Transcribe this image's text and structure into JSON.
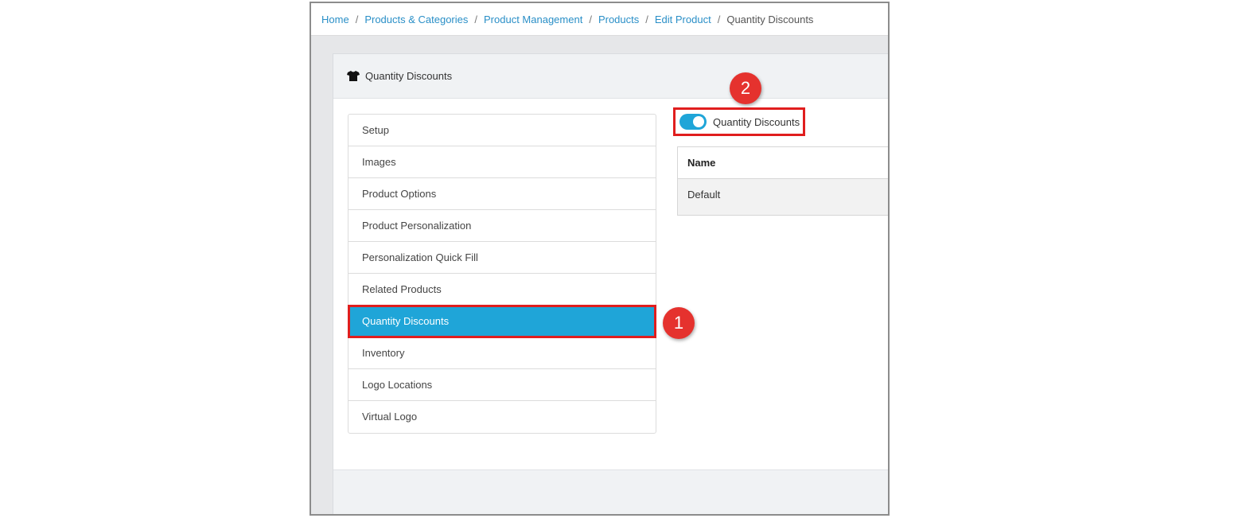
{
  "breadcrumb": {
    "items": [
      "Home",
      "Products & Categories",
      "Product Management",
      "Products",
      "Edit Product"
    ],
    "current": "Quantity Discounts",
    "separator": "/"
  },
  "card": {
    "title": "Quantity Discounts",
    "icon": "tshirt-icon"
  },
  "menu": {
    "items": [
      "Setup",
      "Images",
      "Product Options",
      "Product Personalization",
      "Personalization Quick Fill",
      "Related Products",
      "Quantity Discounts",
      "Inventory",
      "Logo Locations",
      "Virtual Logo"
    ],
    "active_index": 6
  },
  "toggle": {
    "label": "Quantity Discounts",
    "on": true
  },
  "table": {
    "header": "Name",
    "rows": [
      "Default"
    ]
  },
  "annotations": {
    "badge_1": "1",
    "badge_2": "2"
  },
  "colors": {
    "accent": "#1fa5d8",
    "highlight_border": "#e01e1e",
    "badge": "#e5322e",
    "link": "#2a8fc7"
  }
}
